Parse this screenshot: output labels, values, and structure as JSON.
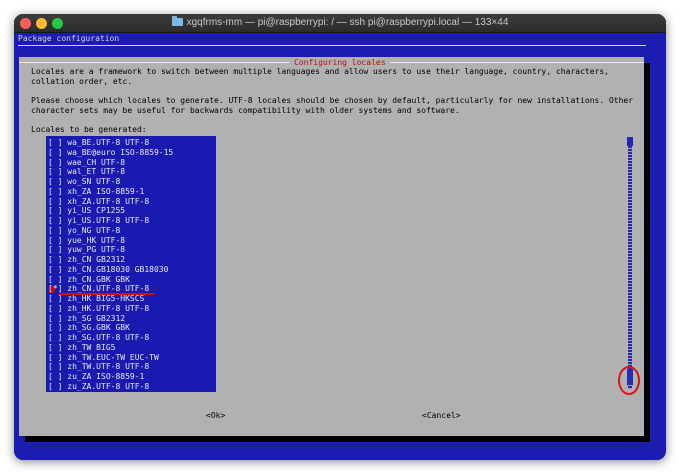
{
  "window": {
    "title": "xgqfrms-mm — pi@raspberrypi: / — ssh pi@raspberrypi.local — 133×44"
  },
  "backtitle": "Package configuration",
  "dialog": {
    "title": "Configuring locales",
    "paragraph1": [
      "Locales are a framework to switch between multiple languages and allow users to use their language, country, characters,",
      "collation order, etc."
    ],
    "paragraph2": [
      "Please choose which locales to generate. UTF-8 locales should be chosen by default, particularly for new installations. Other",
      "character sets may be useful for backwards compatibility with older systems and software."
    ],
    "list_label": "Locales to be generated:",
    "locales": [
      {
        "mark": "[ ]",
        "name": "wa_BE.UTF-8 UTF-8"
      },
      {
        "mark": "[ ]",
        "name": "wa_BE@euro ISO-8859-15"
      },
      {
        "mark": "[ ]",
        "name": "wae_CH UTF-8"
      },
      {
        "mark": "[ ]",
        "name": "wal_ET UTF-8"
      },
      {
        "mark": "[ ]",
        "name": "wo_SN UTF-8"
      },
      {
        "mark": "[ ]",
        "name": "xh_ZA ISO-8859-1"
      },
      {
        "mark": "[ ]",
        "name": "xh_ZA.UTF-8 UTF-8"
      },
      {
        "mark": "[ ]",
        "name": "yi_US CP1255"
      },
      {
        "mark": "[ ]",
        "name": "yi_US.UTF-8 UTF-8"
      },
      {
        "mark": "[ ]",
        "name": "yo_NG UTF-8"
      },
      {
        "mark": "[ ]",
        "name": "yue_HK UTF-8"
      },
      {
        "mark": "[ ]",
        "name": "yuw_PG UTF-8"
      },
      {
        "mark": "[ ]",
        "name": "zh_CN GB2312"
      },
      {
        "mark": "[ ]",
        "name": "zh_CN.GB18030 GB18030"
      },
      {
        "mark": "[ ]",
        "name": "zh_CN.GBK GBK"
      },
      {
        "mark": "[*]",
        "name": "zh_CN.UTF-8 UTF-8"
      },
      {
        "mark": "[ ]",
        "name": "zh_HK BIG5-HKSCS"
      },
      {
        "mark": "[ ]",
        "name": "zh_HK.UTF-8 UTF-8"
      },
      {
        "mark": "[ ]",
        "name": "zh_SG GB2312"
      },
      {
        "mark": "[ ]",
        "name": "zh_SG.GBK GBK"
      },
      {
        "mark": "[ ]",
        "name": "zh_SG.UTF-8 UTF-8"
      },
      {
        "mark": "[ ]",
        "name": "zh_TW BIG5"
      },
      {
        "mark": "[ ]",
        "name": "zh_TW.EUC-TW EUC-TW"
      },
      {
        "mark": "[ ]",
        "name": "zh_TW.UTF-8 UTF-8"
      },
      {
        "mark": "[ ]",
        "name": "zu_ZA ISO-8859-1"
      },
      {
        "mark": "[ ]",
        "name": "zu_ZA.UTF-8 UTF-8"
      }
    ],
    "ok_label": "<Ok>",
    "cancel_label": "<Cancel>"
  },
  "colors": {
    "terminal_bg": "#1c1cb0",
    "dialog_bg": "#b1b1b1",
    "title_red": "#b01010",
    "annotation_red": "#dd1111"
  }
}
